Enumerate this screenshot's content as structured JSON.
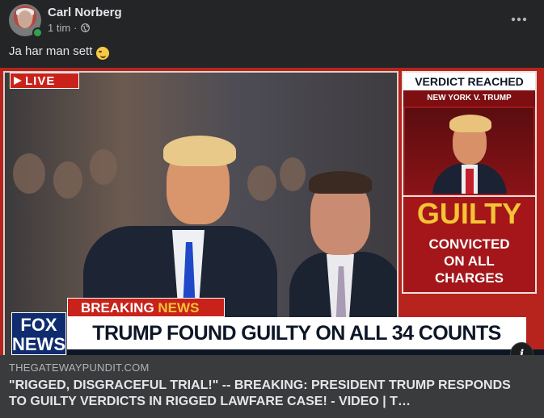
{
  "post": {
    "author": "Carl Norberg",
    "time": "1 tim",
    "audience_icon": "globe-icon",
    "text": "Ja har man sett",
    "emoji": "winking-face-emoji",
    "more_icon": "more-horizontal-icon"
  },
  "media": {
    "live_label": "LIVE",
    "verdict_title": "VERDICT REACHED",
    "verdict_subtitle": "NEW YORK V. TRUMP",
    "guilty_label": "GUILTY",
    "convicted_line1": "CONVICTED",
    "convicted_line2": "ON ALL",
    "convicted_line3": "CHARGES",
    "breaking_word1": "BREAKING",
    "breaking_word2": "NEWS",
    "headline": "TRUMP FOUND GUILTY ON ALL 34 COUNTS",
    "logo_line1": "FOX",
    "logo_line2": "NEWS",
    "info_label": "i"
  },
  "link": {
    "domain": "THEGATEWAYPUNDIT.COM",
    "title": "\"RIGGED, DISGRACEFUL TRIAL!\" -- BREAKING: PRESIDENT TRUMP RESPONDS TO GUILTY VERDICTS IN RIGGED LAWFARE CASE! - VIDEO | T…"
  },
  "colors": {
    "background": "#242526",
    "link_box": "#3a3b3c",
    "online": "#31a24c",
    "news_red": "#c8221b",
    "news_gold": "#f3c433"
  }
}
